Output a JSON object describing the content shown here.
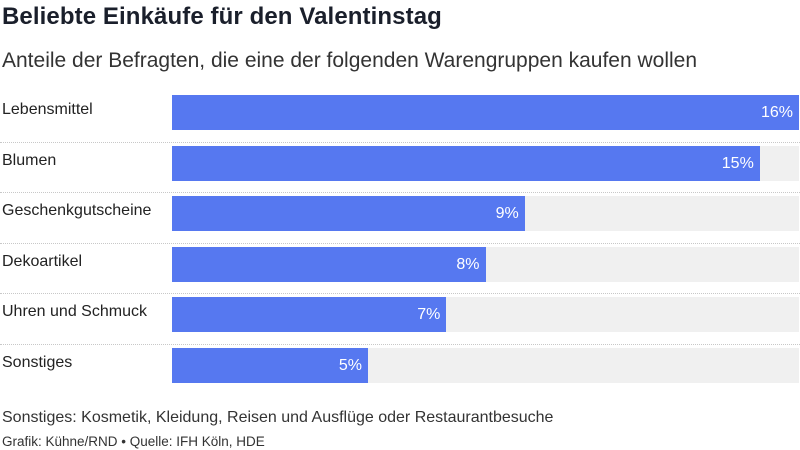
{
  "title": "Beliebte Einkäufe für den Valentinstag",
  "subtitle": "Anteile der Befragten, die eine der folgenden Warengruppen kaufen wollen",
  "note": "Sonstiges: Kosmetik, Kleidung, Reisen und Ausflüge oder Restaurantbesuche",
  "source": "Grafik: Kühne/RND • Quelle: IFH Köln, HDE",
  "colors": {
    "bar": "#5678f0",
    "track": "#f0f0f0",
    "value_label": "#ffffff"
  },
  "chart_data": {
    "type": "bar",
    "orientation": "horizontal",
    "categories": [
      "Lebensmittel",
      "Blumen",
      "Geschenkgutscheine",
      "Dekoartikel",
      "Uhren und Schmuck",
      "Sonstiges"
    ],
    "values": [
      16,
      15,
      9,
      8,
      7,
      5
    ],
    "value_labels": [
      "16%",
      "15%",
      "9%",
      "8%",
      "7%",
      "5%"
    ],
    "unit": "%",
    "xlim": [
      0,
      16
    ],
    "grid": false,
    "legend": "none"
  }
}
